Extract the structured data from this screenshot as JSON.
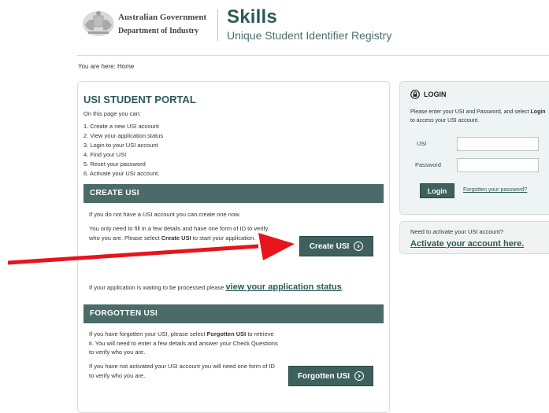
{
  "header": {
    "gov_line1": "Australian Government",
    "gov_line2": "Department of Industry",
    "brand_title": "Skills",
    "brand_subtitle": "Unique Student Identifier Registry"
  },
  "breadcrumb": "You are here:  Home",
  "portal": {
    "title": "USI STUDENT PORTAL",
    "intro": "On this page you can:",
    "steps": [
      "1.   Create a new USI account",
      "2.   View your application status",
      "3.   Login to your USI account",
      "4.   Find your USI",
      "5.   Reset your password",
      "6.   Activate your USI account."
    ]
  },
  "create_usi": {
    "heading": "CREATE USI",
    "para1": "If you do not have a USI account you can create one now.",
    "para2_a": "You only need to fill in a few details and have one form of ID to verify who you are. Please select ",
    "para2_b": "Create USI",
    "para2_c": " to start your application.",
    "button_label": "Create USI",
    "status_text": "If your application is waiting to be processed please ",
    "status_link": "view your application status",
    "status_end": "."
  },
  "forgotten_usi": {
    "heading": "FORGOTTEN USI",
    "para1_a": "If you have forgotten your USI, please select ",
    "para1_b": "Forgotten USI",
    "para1_c": " to retrieve it. You will need to enter a few details and answer your Check Questions to verify who you are.",
    "para2": "If you have not activated your USI account you will need one form of ID to verify who you are.",
    "button_label": "Forgotten USI"
  },
  "login": {
    "title": "LOGIN",
    "desc_a": "Please enter your USI and Password, and select ",
    "desc_b": "Login",
    "desc_c": " to access your USI account.",
    "usi_label": "USI",
    "password_label": "Password",
    "usi_value": "",
    "password_value": "",
    "button_label": "Login",
    "forgot_password_link": "Forgotten your password?"
  },
  "activate": {
    "question": "Need to activate your USI account?",
    "link": "Activate your account here."
  },
  "colors": {
    "brand_green": "#2d5a57",
    "bar_green": "#4b6b68",
    "button_green": "#3e615d",
    "arrow_red": "#e8141c"
  },
  "icons": {
    "crest": "commonwealth-crest-icon",
    "chevron": "circle-chevron-right-icon",
    "lock": "lock-icon"
  }
}
